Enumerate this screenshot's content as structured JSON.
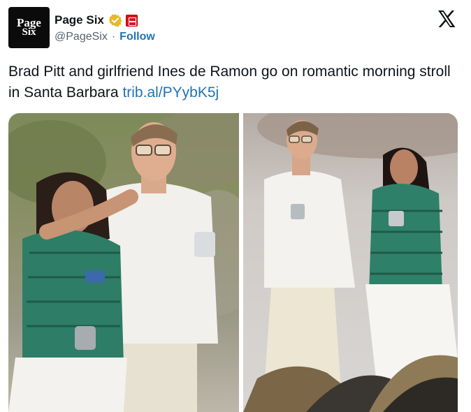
{
  "account": {
    "avatar_line1": "Page",
    "avatar_line2": "Six",
    "display_name": "Page Six",
    "handle": "@PageSix",
    "separator": "·",
    "follow_label": "Follow",
    "verified_icon": "verified-badge-icon",
    "affiliate_icon": "affiliate-badge-icon"
  },
  "platform": {
    "logo_icon": "x-logo-icon"
  },
  "tweet": {
    "text": "Brad Pitt and girlfriend Ines de Ramon go on romantic morning stroll in Santa Barbara ",
    "link_text": "trib.al/PYybK5j"
  },
  "colors": {
    "link": "#1d74b5",
    "text": "#0f1419",
    "muted": "#536471",
    "verified": "#e8b829"
  }
}
